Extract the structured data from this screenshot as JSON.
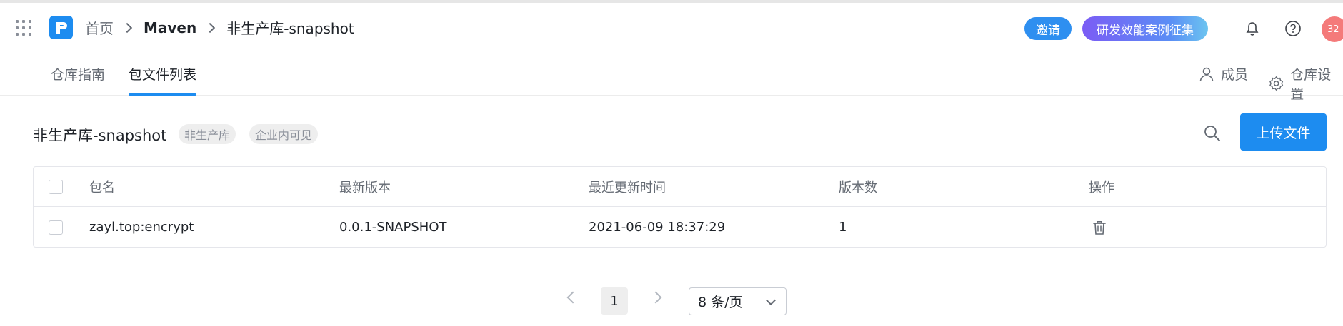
{
  "breadcrumb": {
    "home": "首页",
    "repo_type": "Maven",
    "repo_name": "非生产库-snapshot"
  },
  "header": {
    "invite_label": "邀请",
    "campaign_label": "研发效能案例征集",
    "avatar_text": "32",
    "icons": [
      "apps-grid-icon",
      "logo-icon",
      "bell-icon",
      "help-icon"
    ]
  },
  "tabs": {
    "guide": "仓库指南",
    "files": "包文件列表",
    "active": "files",
    "members": "成员",
    "settings": "仓库设置"
  },
  "repo": {
    "title": "非生产库-snapshot",
    "tags": [
      "非生产库",
      "企业内可见"
    ],
    "upload_label": "上传文件"
  },
  "table": {
    "columns": [
      "包名",
      "最新版本",
      "最近更新时间",
      "版本数",
      "操作"
    ],
    "rows": [
      {
        "name": "zayl.top:encrypt",
        "latest_version": "0.0.1-SNAPSHOT",
        "updated_at": "2021-06-09 18:37:29",
        "version_count": "1"
      }
    ]
  },
  "pagination": {
    "current_page": "1",
    "page_size": "8 条/页"
  },
  "colors": {
    "accent": "#1d8cf0",
    "invite_bg": "#2e8ff0",
    "avatar_bg": "#f47a7a"
  }
}
